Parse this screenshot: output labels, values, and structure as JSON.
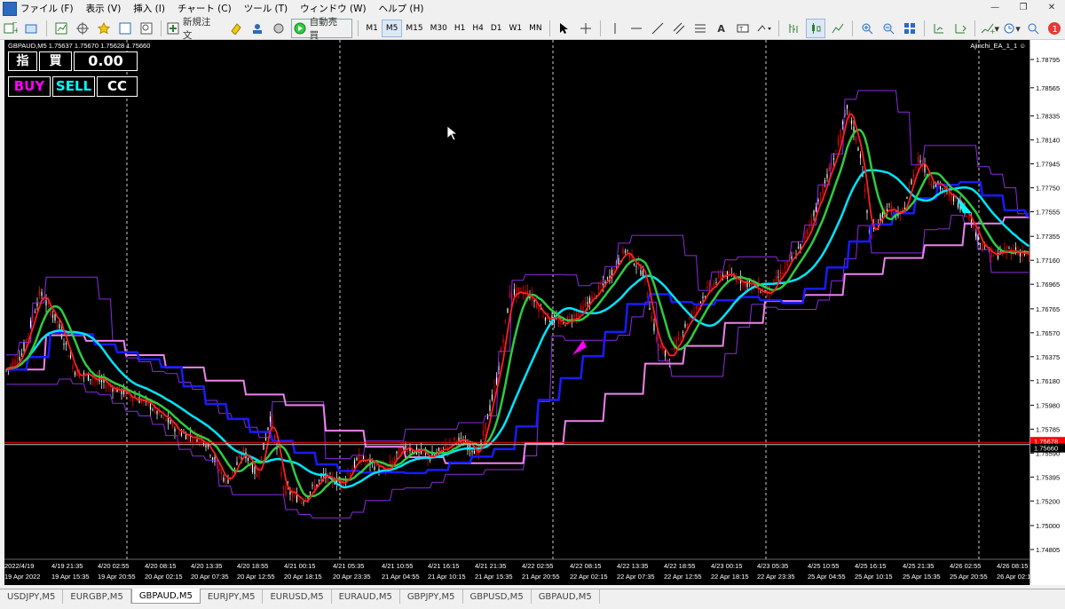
{
  "menubar": {
    "items": [
      "ファイル (F)",
      "表示 (V)",
      "挿入 (I)",
      "チャート (C)",
      "ツール (T)",
      "ウィンドウ (W)",
      "ヘルプ (H)"
    ]
  },
  "toolbar": {
    "new_order": "新規注文",
    "auto_trade": "自動売買",
    "timeframes": [
      "M1",
      "M5",
      "M15",
      "M30",
      "H1",
      "H4",
      "D1",
      "W1",
      "MN"
    ],
    "active_timeframe": "M5",
    "notification_count": "1"
  },
  "chart": {
    "header": "GBPAUD,M5  1.75637 1.75670 1.75628 1.75660",
    "ea_label": "Ajinchi_EA_1_1",
    "panel": {
      "price_type_label": "指",
      "side_label": "買",
      "lot_value": "0.00",
      "buy_label": "BUY",
      "sell_label": "SELL",
      "cc_label": "CC"
    },
    "price_labels": [
      "1.78795",
      "1.78565",
      "1.78335",
      "1.78140",
      "1.77945",
      "1.77750",
      "1.77555",
      "1.77355",
      "1.77160",
      "1.76965",
      "1.76765",
      "1.76570",
      "1.76375",
      "1.76180",
      "1.75980",
      "1.75785",
      "1.75590",
      "1.75395",
      "1.75200",
      "1.75000",
      "1.74805"
    ],
    "red_price": "1.75678",
    "current_price": "1.75660",
    "time_labels": [
      "2022/4/19",
      "4/19 21:35",
      "4/20 02:55",
      "4/20 08:15",
      "4/20 13:35",
      "4/20 18:55",
      "4/21 00:15",
      "4/21 05:35",
      "4/21 10:55",
      "4/21 16:15",
      "4/21 21:35",
      "4/22 02:55",
      "4/22 08:15",
      "4/22 13:35",
      "4/22 18:55",
      "4/23 00:15",
      "4/23 05:35",
      "4/25 10:55",
      "4/25 16:15",
      "4/25 21:35",
      "4/26 02:55",
      "4/26 08:15"
    ],
    "time_labels_2": [
      "19 Apr 2022",
      "19 Apr 15:35",
      "19 Apr 20:55",
      "20 Apr 02:15",
      "20 Apr 07:35",
      "20 Apr 12:55",
      "20 Apr 18:15",
      "20 Apr 23:35",
      "21 Apr 04:55",
      "21 Apr 10:15",
      "21 Apr 15:35",
      "21 Apr 20:55",
      "22 Apr 02:15",
      "22 Apr 07:35",
      "22 Apr 12:55",
      "22 Apr 18:15",
      "22 Apr 23:35",
      "25 Apr 04:55",
      "25 Apr 10:15",
      "25 Apr 15:35",
      "25 Apr 20:55",
      "26 Apr 02:15"
    ],
    "colors": {
      "background": "#000000",
      "candle_up": "#ffffff",
      "candle_down": "#ff0000",
      "ma_fast": "#ff2020",
      "ma_green": "#2ecc40",
      "ma_cyan": "#00e5ff",
      "ma_blue": "#1a1aff",
      "channel_pink": "#ee82ee",
      "channel_purple": "#8a2be2",
      "buy": "#ff00ff",
      "sell": "#00ffff"
    }
  },
  "tabs": {
    "items": [
      "USDJPY,M5",
      "EURGBP,M5",
      "GBPAUD,M5",
      "EURJPY,M5",
      "EURUSD,M5",
      "EURAUD,M5",
      "GBPJPY,M5",
      "GBPUSD,M5",
      "GBPAUD,M5"
    ],
    "active": "GBPAUD,M5"
  }
}
